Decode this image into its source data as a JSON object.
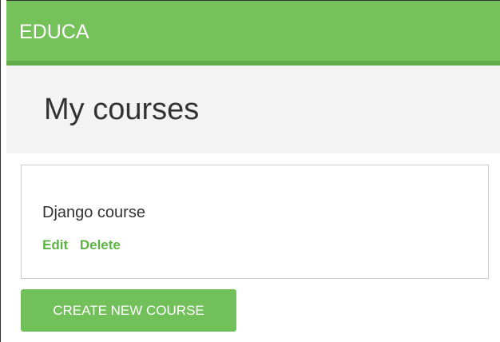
{
  "header": {
    "logo_text": "EDUCA"
  },
  "page": {
    "title": "My courses"
  },
  "courses": [
    {
      "title": "Django course",
      "edit_label": "Edit",
      "delete_label": "Delete"
    }
  ],
  "actions": {
    "create_label": "CREATE NEW COURSE"
  },
  "colors": {
    "brand_green": "#75c15a",
    "link_green": "#5cb543",
    "heading_band": "#f3f3f3",
    "text": "#333333"
  }
}
